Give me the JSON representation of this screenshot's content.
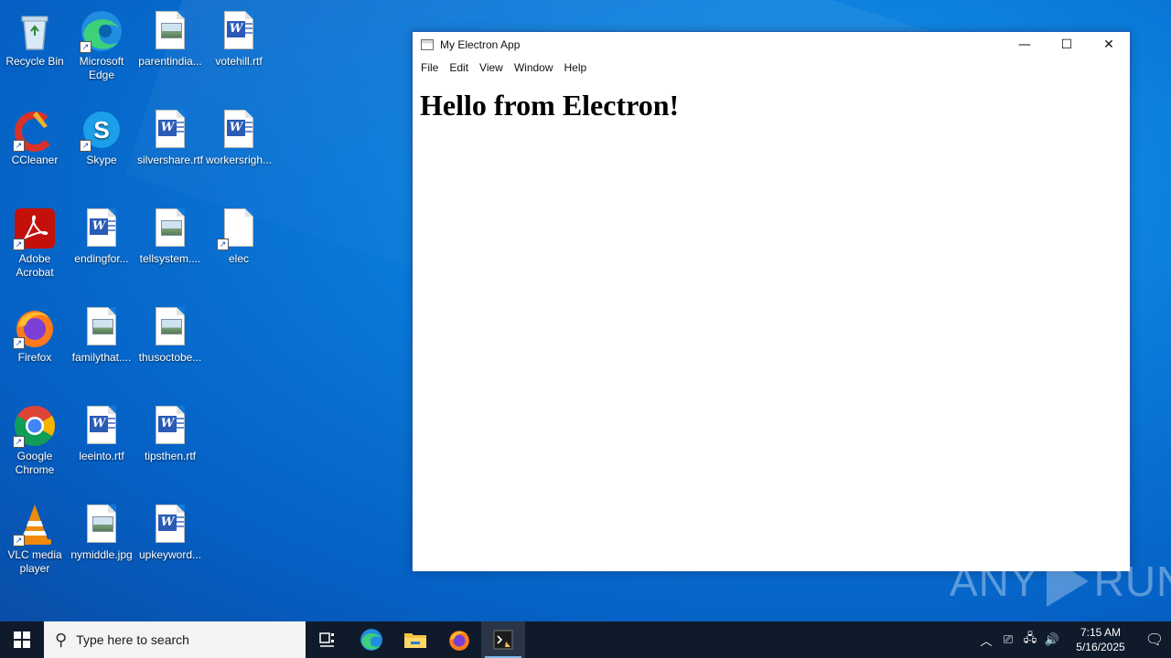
{
  "desktop": {
    "icons": [
      {
        "label": "Recycle Bin",
        "icon": "recycle-bin-icon"
      },
      {
        "label": "Microsoft Edge",
        "icon": "edge-icon"
      },
      {
        "label": "parentindia...",
        "icon": "image-file-icon"
      },
      {
        "label": "votehill.rtf",
        "icon": "word-doc-icon"
      },
      {
        "label": "CCleaner",
        "icon": "ccleaner-icon"
      },
      {
        "label": "Skype",
        "icon": "skype-icon"
      },
      {
        "label": "silvershare.rtf",
        "icon": "word-doc-icon"
      },
      {
        "label": "workersrigh...",
        "icon": "word-doc-icon"
      },
      {
        "label": "Adobe Acrobat",
        "icon": "acrobat-icon"
      },
      {
        "label": "endingfor...",
        "icon": "word-doc-icon"
      },
      {
        "label": "tellsystem....",
        "icon": "image-file-icon"
      },
      {
        "label": "elec",
        "icon": "blank-file-icon"
      },
      {
        "label": "Firefox",
        "icon": "firefox-icon"
      },
      {
        "label": "familythat....",
        "icon": "image-file-icon"
      },
      {
        "label": "thusoctobe...",
        "icon": "image-file-icon"
      },
      {
        "label": "Google Chrome",
        "icon": "chrome-icon"
      },
      {
        "label": "leeinto.rtf",
        "icon": "word-doc-icon"
      },
      {
        "label": "tipsthen.rtf",
        "icon": "word-doc-icon"
      },
      {
        "label": "VLC media player",
        "icon": "vlc-icon"
      },
      {
        "label": "nymiddle.jpg",
        "icon": "image-file-icon"
      },
      {
        "label": "upkeyword...",
        "icon": "word-doc-icon"
      }
    ]
  },
  "window": {
    "title": "My Electron App",
    "minimize": "—",
    "maximize": "☐",
    "close": "✕",
    "menu": [
      "File",
      "Edit",
      "View",
      "Window",
      "Help"
    ],
    "heading": "Hello from Electron!"
  },
  "watermark": {
    "left": "ANY",
    "right": "RUN"
  },
  "taskbar": {
    "search_placeholder": "Type here to search",
    "pinned": [
      "task-view-icon",
      "edge-icon",
      "file-explorer-icon",
      "firefox-icon",
      "electron-app-icon"
    ],
    "time": "7:15 AM",
    "date": "5/16/2025"
  }
}
